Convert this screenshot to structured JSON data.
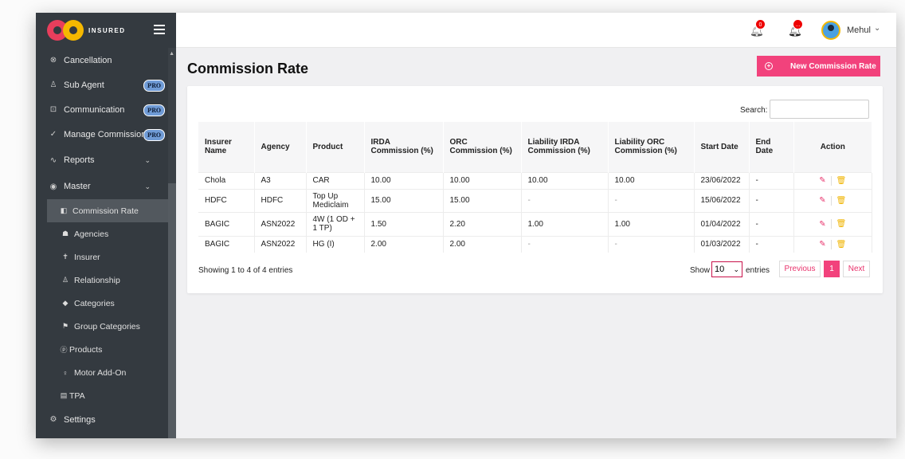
{
  "app": {
    "logo_text": "INSURED"
  },
  "sidebar": {
    "items": [
      {
        "label": "Cancellation",
        "icon": "circle-x-icon"
      },
      {
        "label": "Sub Agent",
        "icon": "user-icon",
        "badge": "PRO"
      },
      {
        "label": "Communication",
        "icon": "chat-icon",
        "badge": "PRO"
      },
      {
        "label": "Manage Commission",
        "icon": "check-icon",
        "badge": "PRO"
      },
      {
        "label": "Reports",
        "icon": "pulse-icon"
      },
      {
        "label": "Master",
        "icon": "gear-circle-icon"
      }
    ],
    "master_items": [
      {
        "label": "Commission Rate",
        "icon": "tag-icon"
      },
      {
        "label": "Agencies",
        "icon": "users-icon"
      },
      {
        "label": "Insurer",
        "icon": "person-icon"
      },
      {
        "label": "Relationship",
        "icon": "user-outline-icon"
      },
      {
        "label": "Categories",
        "icon": "cube-icon"
      },
      {
        "label": "Group Categories",
        "icon": "flag-icon"
      },
      {
        "label": "Products",
        "icon": "p-circle-icon"
      },
      {
        "label": "Motor Add-On",
        "icon": "bulb-icon"
      },
      {
        "label": "TPA",
        "icon": "building-icon"
      }
    ],
    "settings_label": "Settings"
  },
  "topbar": {
    "notif_count": "0",
    "msg_badge": "...",
    "user_name": "Mehul"
  },
  "page": {
    "title": "Commission Rate",
    "new_button": "New Commission Rate",
    "search_label": "Search:"
  },
  "table": {
    "headers": [
      "Insurer Name",
      "Agency",
      "Product",
      "IRDA Commission (%)",
      "ORC Commission (%)",
      "Liability IRDA Commission (%)",
      "Liability ORC Commission (%)",
      "Start Date",
      "End Date",
      "Action"
    ],
    "rows": [
      [
        "Chola",
        "A3",
        "CAR",
        "10.00",
        "10.00",
        "10.00",
        "10.00",
        "23/06/2022",
        "-"
      ],
      [
        "HDFC",
        "HDFC",
        "Top Up Mediclaim",
        "15.00",
        "15.00",
        "-",
        "-",
        "15/06/2022",
        "-"
      ],
      [
        "BAGIC",
        "ASN2022",
        "4W (1 OD + 1 TP)",
        "1.50",
        "2.20",
        "1.00",
        "1.00",
        "01/04/2022",
        "-"
      ],
      [
        "BAGIC",
        "ASN2022",
        "HG (I)",
        "2.00",
        "2.00",
        "-",
        "-",
        "01/03/2022",
        "-"
      ]
    ]
  },
  "footer": {
    "showing": "Showing 1 to 4 of 4 entries",
    "show_label": "Show",
    "page_size": "10",
    "entries_label": "entries",
    "prev": "Previous",
    "current_page": "1",
    "next": "Next"
  },
  "colors": {
    "accent": "#f2427c",
    "sidebar_bg": "#343a40"
  }
}
